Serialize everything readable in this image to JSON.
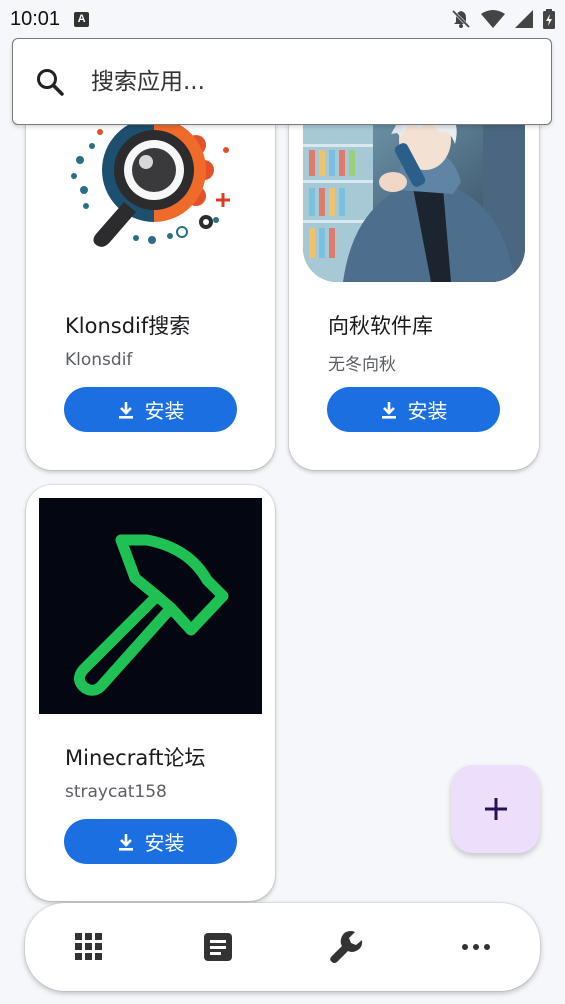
{
  "status_bar": {
    "time": "10:01",
    "notification_badge": "A",
    "icons": [
      "bell-off-icon",
      "wifi-icon",
      "signal-icon",
      "battery-charging-icon"
    ]
  },
  "search": {
    "placeholder": "搜索应用...",
    "icon": "search-icon"
  },
  "apps": [
    {
      "title": "Klonsdif搜索",
      "author": "Klonsdif",
      "install_label": "安装",
      "image": "magnifier-gear-logo"
    },
    {
      "title": "向秋软件库",
      "author": "无冬向秋",
      "install_label": "安装",
      "image": "anime-character-drinking"
    },
    {
      "title": "Minecraft论坛",
      "author": "straycat158",
      "install_label": "安装",
      "image": "green-hammer-logo"
    }
  ],
  "fab": {
    "icon": "plus-icon"
  },
  "bottom_nav": {
    "items": [
      "apps-grid-icon",
      "article-icon",
      "wrench-icon",
      "more-horiz-icon"
    ]
  },
  "colors": {
    "primary": "#1b6fe0",
    "fab_bg": "#ecdffb",
    "fab_fg": "#2a0e57",
    "background": "#f6f7fb",
    "hammer_green": "#1fc054"
  }
}
